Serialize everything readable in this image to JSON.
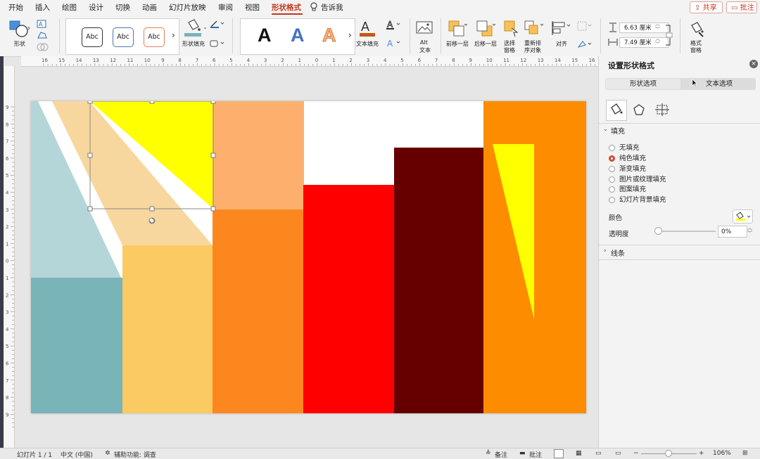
{
  "menu": {
    "tabs": [
      "开始",
      "插入",
      "绘图",
      "设计",
      "切换",
      "动画",
      "幻灯片放映",
      "审阅",
      "视图",
      "形状格式"
    ],
    "active_tab": "形状格式",
    "tell_me": "告诉我",
    "share": "共享",
    "comments": "批注"
  },
  "ribbon": {
    "shape_label": "形状",
    "style_samples": [
      "Abc",
      "Abc",
      "Abc"
    ],
    "shape_fill_label": "形状填充",
    "wordart_samples": [
      "A",
      "A",
      "A"
    ],
    "text_fill_label": "文本填充",
    "alt_text_label": "Alt\n文本",
    "alt_line1": "Alt",
    "alt_line2": "文本",
    "bring_forward_label": "前移一层",
    "send_backward_label": "后移一层",
    "selection_pane_line1": "选择",
    "selection_pane_line2": "窗格",
    "reorder_line1": "重新排",
    "reorder_line2": "序对象",
    "align_label": "对齐",
    "height_value": "6.63 厘米",
    "width_value": "7.49 厘米",
    "format_pane_line1": "格式",
    "format_pane_line2": "窗格"
  },
  "ruler": {
    "h_ticks": [
      "16",
      "15",
      "14",
      "13",
      "12",
      "11",
      "10",
      "9",
      "8",
      "7",
      "6",
      "5",
      "4",
      "3",
      "2",
      "1",
      "0",
      "1",
      "2",
      "3",
      "4",
      "5",
      "6",
      "7",
      "8",
      "9",
      "10",
      "11",
      "12",
      "13",
      "14",
      "15",
      "16"
    ],
    "v_ticks": [
      "9",
      "8",
      "7",
      "6",
      "5",
      "4",
      "3",
      "2",
      "1",
      "0",
      "1",
      "2",
      "3",
      "4",
      "5",
      "6",
      "7",
      "8",
      "9"
    ]
  },
  "slide_shapes": {
    "colors": {
      "light_teal": "#b5d6d8",
      "teal": "#79b4b9",
      "peach": "#f8d79e",
      "light_orange": "#fdb06d",
      "orange": "#fc871f",
      "yellow_orange": "#fbca62",
      "yellow": "#ffff00",
      "red": "#ff0000",
      "maroon": "#660000",
      "deep_orange": "#fd8c00"
    }
  },
  "pane": {
    "title": "设置形状格式",
    "tabs": [
      "形状选项",
      "文本选项"
    ],
    "fill_section": "填充",
    "fill_options": [
      "无填充",
      "纯色填充",
      "渐变填充",
      "图片或纹理填充",
      "图案填充",
      "幻灯片背景填充"
    ],
    "selected_fill": "纯色填充",
    "color_label": "颜色",
    "transparency_label": "透明度",
    "transparency_value": "0%",
    "transparency_level": 0,
    "line_section": "线条"
  },
  "status": {
    "slide_counter": "幻灯片 1 / 1",
    "language": "中文 (中国)",
    "accessibility": "辅助功能: 调查",
    "notes": "备注",
    "comments": "批注",
    "zoom": "106%"
  }
}
